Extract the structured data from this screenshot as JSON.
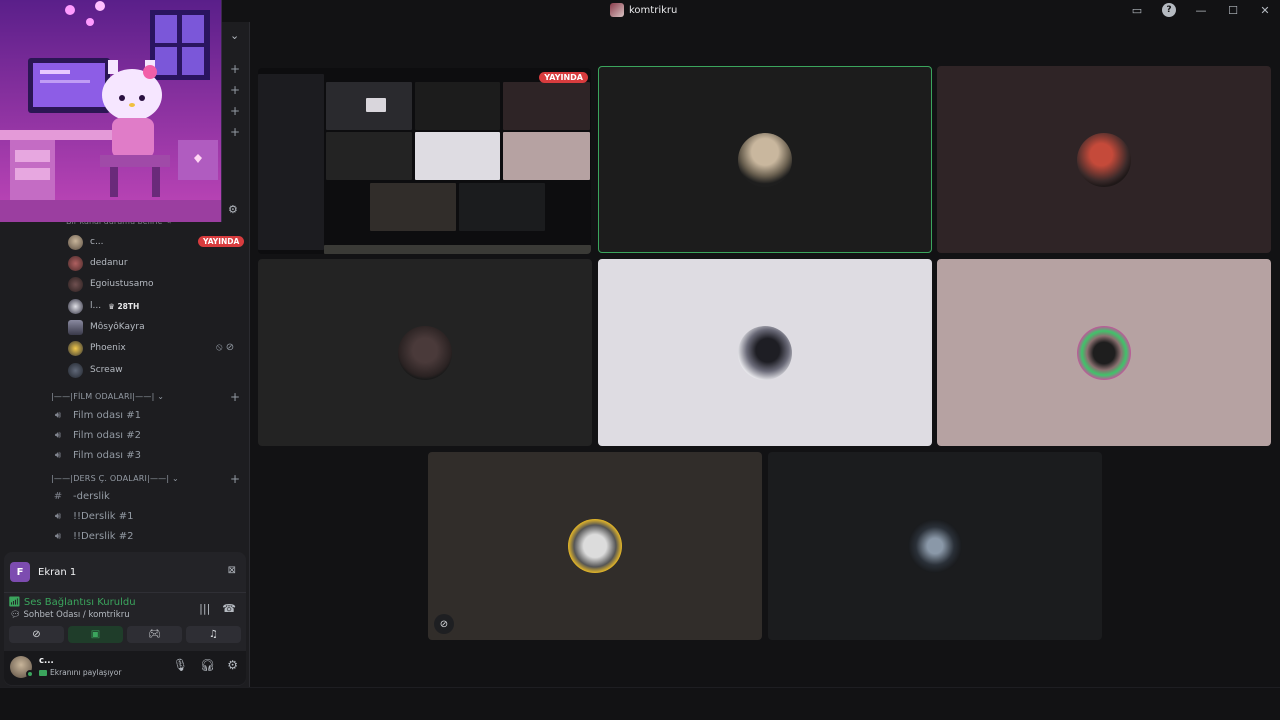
{
  "window": {
    "title": "komtrikru"
  },
  "sidebar": {
    "channel_status": "Bir kanal durumu belirle",
    "members": [
      {
        "name": "c...",
        "live_badge": "YAYINDA"
      },
      {
        "name": "dedanur"
      },
      {
        "name": "Egoiustusamo"
      },
      {
        "name": "l...",
        "boost": "28TH"
      },
      {
        "name": "MôsyôKayra"
      },
      {
        "name": "Phoenix"
      },
      {
        "name": "Screaw"
      }
    ],
    "categories": [
      {
        "label": "|——|FİLM ODALARI|——|",
        "channels": [
          "Film odası #1",
          "Film odası #2",
          "Film odası #3"
        ]
      },
      {
        "label": "|——|DERS Ç. ODALARI|——|",
        "channels": [
          "-derslik",
          "!!Derslik #1",
          "!!Derslik #2"
        ]
      }
    ]
  },
  "voice_panel": {
    "screen_avatar_letter": "F",
    "screen_label": "Ekran 1",
    "connection_status": "Ses Bağlantısı Kuruldu",
    "connection_channel": "Sohbet Odası / komtrikru"
  },
  "user": {
    "name": "c...",
    "status": "Ekranını paylaşıyor"
  },
  "stage": {
    "stream_badge": "YAYINDA",
    "stream_header": "komtrikru"
  },
  "colors": {
    "accent_green": "#3ba55d",
    "live_red": "#d83c3e",
    "background": "#121214"
  }
}
